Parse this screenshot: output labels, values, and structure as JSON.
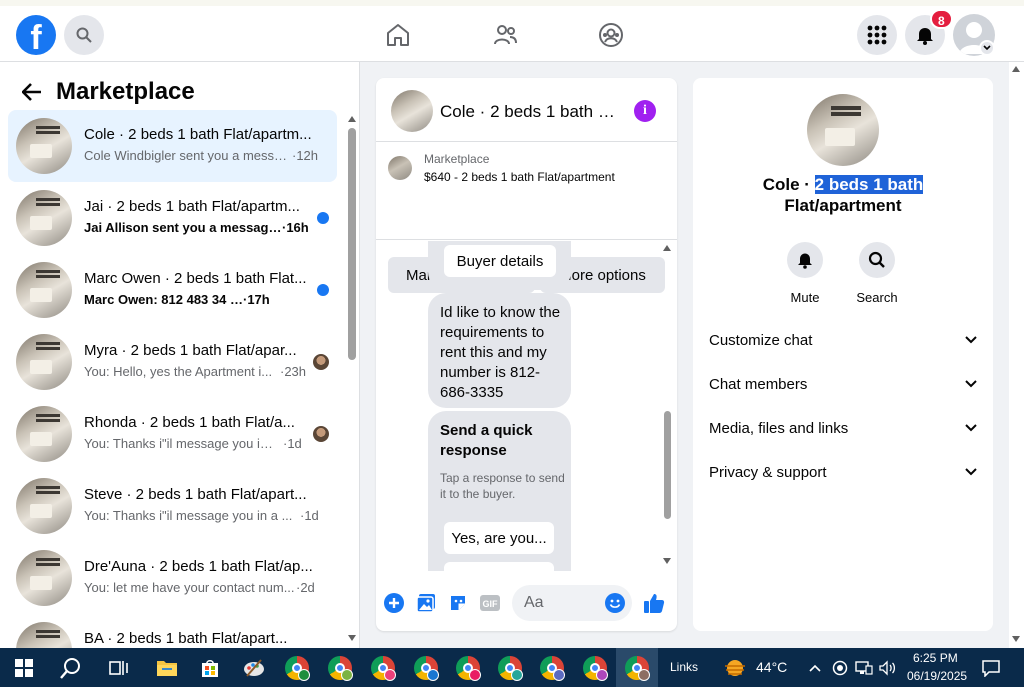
{
  "header": {
    "logo": "f",
    "notifications_count": "8"
  },
  "sidebar": {
    "title": "Marketplace",
    "conversations": [
      {
        "title": "Cole · 2 beds 1 bath Flat/apartm...",
        "preview": "Cole Windbigler sent you a messa...",
        "time": "·12h",
        "active": true,
        "unread": false
      },
      {
        "title": "Jai · 2 beds 1 bath Flat/apartm...",
        "preview": "Jai Allison sent you a message ...",
        "time": "·16h",
        "unread": true
      },
      {
        "title": "Marc Owen · 2 beds 1 bath Flat...",
        "preview": "Marc Owen: 812 483 34 07",
        "time": "·17h",
        "unread": true
      },
      {
        "title": "Myra · 2 beds 1 bath Flat/apar...",
        "preview": "You: Hello, yes the Apartment i...",
        "time": "·23h",
        "unread": false
      },
      {
        "title": "Rhonda · 2 beds 1 bath Flat/a...",
        "preview": "You: Thanks i\"il message you in ...",
        "time": "·1d",
        "unread": false
      },
      {
        "title": "Steve · 2 beds 1 bath Flat/apart...",
        "preview": "You: Thanks i\"il message you in a ...",
        "time": "·1d",
        "unread": false
      },
      {
        "title": "Dre'Auna · 2 beds 1 bath Flat/ap...",
        "preview": "You: let me have your contact num...",
        "time": "·2d",
        "unread": false
      },
      {
        "title": "BA · 2 beds 1 bath Flat/apart...",
        "preview": "",
        "time": "",
        "unread": false
      }
    ]
  },
  "chat": {
    "title": "Cole · 2 beds 1 bath F...",
    "listing_category": "Marketplace",
    "listing_price": "$640 - 2 beds 1 bath Flat/apartment",
    "mark_pending_label": "Mark as pending",
    "more_options_label": "More options",
    "buyer_details_label": "Buyer details",
    "message": "Id like to know the requirements to rent this and my number is 812-686-3335",
    "quick_response_title": "Send a quick response",
    "quick_response_sub": "Tap a response to send it to the buyer.",
    "quick_reply_label": "Yes, are you...",
    "input_placeholder": "Aa"
  },
  "details": {
    "name_prefix": "Cole · ",
    "name_highlight": "2 beds 1 bath",
    "name_rest": "Flat/apartment",
    "mute_label": "Mute",
    "search_label": "Search",
    "rows": [
      "Customize chat",
      "Chat members",
      "Media, files and links",
      "Privacy & support"
    ]
  },
  "taskbar": {
    "links_label": "Links",
    "temperature": "44°C",
    "time": "6:25 PM",
    "date": "06/19/2025"
  },
  "colors": {
    "brand": "#1877f2",
    "selection": "#1f63d8",
    "badge": "#e41e3f",
    "info": "#a020f0"
  }
}
